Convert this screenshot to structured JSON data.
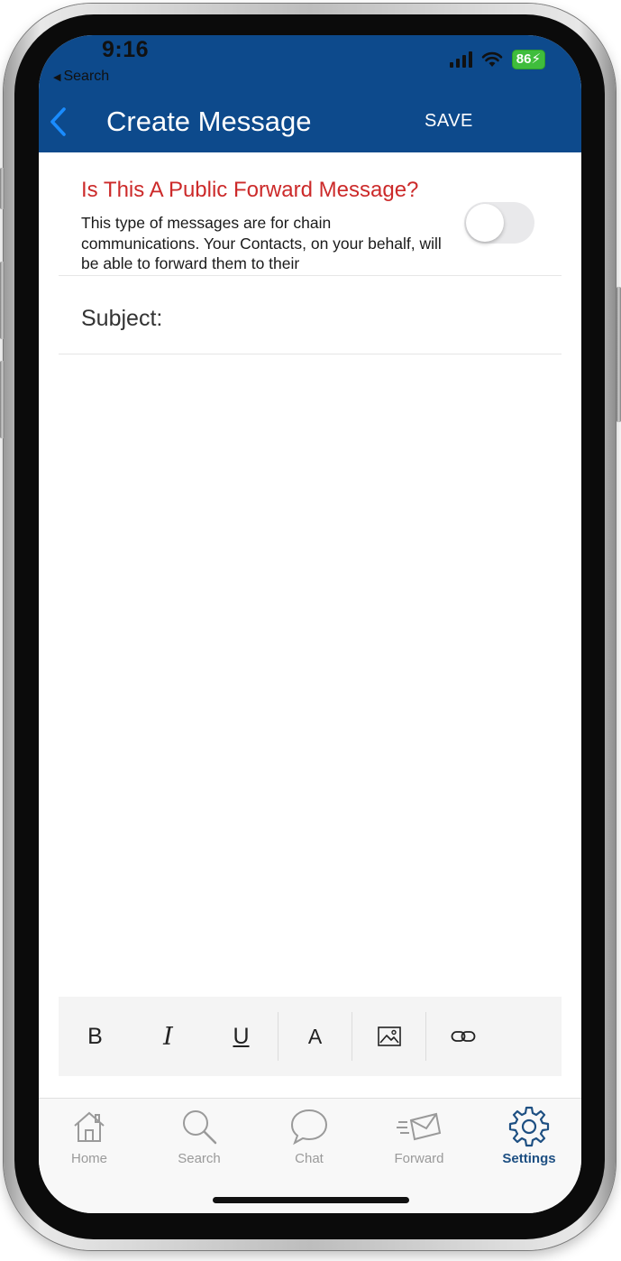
{
  "status_bar": {
    "time": "9:16",
    "back_app": "Search",
    "battery": "86"
  },
  "header": {
    "title": "Create Message",
    "save_label": "SAVE"
  },
  "forward_option": {
    "title": "Is This A Public Forward Message?",
    "description": "This type of messages are for chain communications. Your Contacts, on your behalf, will be able to forward them to their",
    "enabled": false
  },
  "subject": {
    "label": "Subject:",
    "value": ""
  },
  "toolbar": {
    "bold": "B",
    "italic": "I",
    "underline": "U",
    "text_color": "A"
  },
  "tabs": [
    {
      "label": "Home",
      "icon": "home-icon"
    },
    {
      "label": "Search",
      "icon": "search-icon"
    },
    {
      "label": "Chat",
      "icon": "chat-icon"
    },
    {
      "label": "Forward",
      "icon": "forward-mail-icon"
    },
    {
      "label": "Settings",
      "icon": "gear-icon",
      "active": true
    }
  ],
  "colors": {
    "header_bg": "#0d4a8c",
    "accent_red": "#cc2a2a",
    "active_tab": "#1d4f82",
    "back_chevron": "#1a8cff"
  }
}
